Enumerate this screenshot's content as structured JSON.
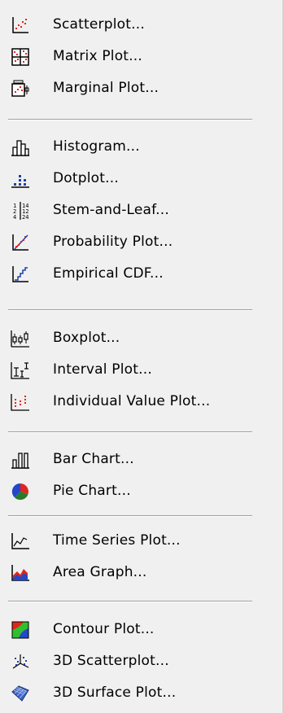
{
  "menu": {
    "items": [
      {
        "label": "Scatterplot...",
        "icon": "scatterplot-icon"
      },
      {
        "label": "Matrix Plot...",
        "icon": "matrix-plot-icon"
      },
      {
        "label": "Marginal Plot...",
        "icon": "marginal-plot-icon"
      },
      {
        "label": "Histogram...",
        "icon": "histogram-icon"
      },
      {
        "label": "Dotplot...",
        "icon": "dotplot-icon"
      },
      {
        "label": "Stem-and-Leaf...",
        "icon": "stem-and-leaf-icon"
      },
      {
        "label": "Probability Plot...",
        "icon": "probability-plot-icon"
      },
      {
        "label": "Empirical CDF...",
        "icon": "empirical-cdf-icon"
      },
      {
        "label": "Boxplot...",
        "icon": "boxplot-icon"
      },
      {
        "label": "Interval Plot...",
        "icon": "interval-plot-icon"
      },
      {
        "label": "Individual Value Plot...",
        "icon": "individual-value-plot-icon"
      },
      {
        "label": "Bar Chart...",
        "icon": "bar-chart-icon"
      },
      {
        "label": "Pie Chart...",
        "icon": "pie-chart-icon"
      },
      {
        "label": "Time Series Plot...",
        "icon": "time-series-plot-icon"
      },
      {
        "label": "Area Graph...",
        "icon": "area-graph-icon"
      },
      {
        "label": "Contour Plot...",
        "icon": "contour-plot-icon"
      },
      {
        "label": "3D Scatterplot...",
        "icon": "3d-scatterplot-icon"
      },
      {
        "label": "3D Surface Plot...",
        "icon": "3d-surface-plot-icon"
      }
    ]
  }
}
